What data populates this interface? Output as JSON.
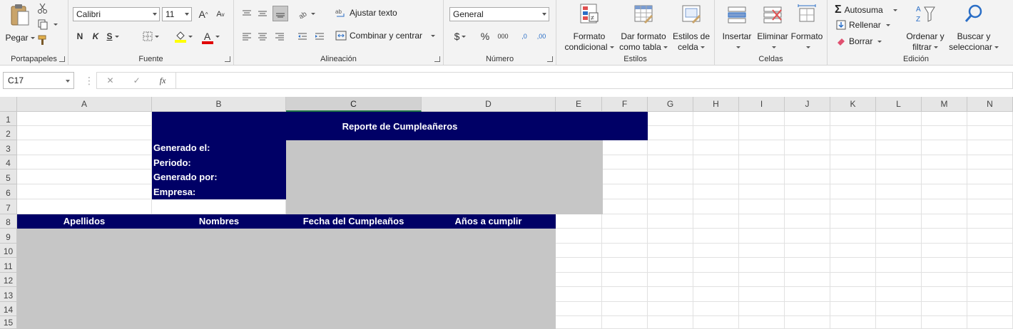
{
  "ribbon": {
    "clipboard": {
      "label": "Portapapeles",
      "paste": "Pegar"
    },
    "font": {
      "label": "Fuente",
      "name": "Calibri",
      "size": "11",
      "bold": "N",
      "italic": "K",
      "underline": "S",
      "grow": "A",
      "shrink": "A",
      "fontcolor": "A"
    },
    "alignment": {
      "label": "Alineación",
      "wrap": "Ajustar texto",
      "merge": "Combinar y centrar"
    },
    "number": {
      "label": "Número",
      "format": "General",
      "currency": "$",
      "percent": "%",
      "thousands": "000",
      "inc_dec": ",0",
      "dec_dec": ",00"
    },
    "styles": {
      "label": "Estilos",
      "conditional": [
        "Formato",
        "condicional"
      ],
      "table": [
        "Dar formato",
        "como tabla"
      ],
      "cell": [
        "Estilos de",
        "celda"
      ]
    },
    "cells": {
      "label": "Celdas",
      "insert": "Insertar",
      "delete": "Eliminar",
      "format": "Formato"
    },
    "editing": {
      "label": "Edición",
      "autosum": "Autosuma",
      "fill": "Rellenar",
      "clear": "Borrar",
      "sort": [
        "Ordenar y",
        "filtrar"
      ],
      "find": [
        "Buscar y",
        "seleccionar"
      ]
    }
  },
  "formula_bar": {
    "namebox": "C17",
    "fx": "fx",
    "cancel": "✕",
    "enter": "✓",
    "value": ""
  },
  "columns": [
    "A",
    "B",
    "C",
    "D",
    "E",
    "F",
    "G",
    "H",
    "I",
    "J",
    "K",
    "L",
    "M",
    "N"
  ],
  "rows": [
    "1",
    "2",
    "3",
    "4",
    "5",
    "6",
    "7",
    "8",
    "9",
    "10",
    "11",
    "12",
    "13",
    "14",
    "15"
  ],
  "sheet": {
    "title": "Reporte de Cumpleañeros",
    "info_labels": [
      "Generado el:",
      "Periodo:",
      "Generado por:",
      "Empresa:"
    ],
    "table_headers": [
      "Apellidos",
      "Nombres",
      "Fecha del Cumpleaños",
      "Años a cumplir"
    ]
  },
  "colors": {
    "navy": "#000066",
    "gray": "#c6c6c6",
    "accent": "#217346"
  }
}
